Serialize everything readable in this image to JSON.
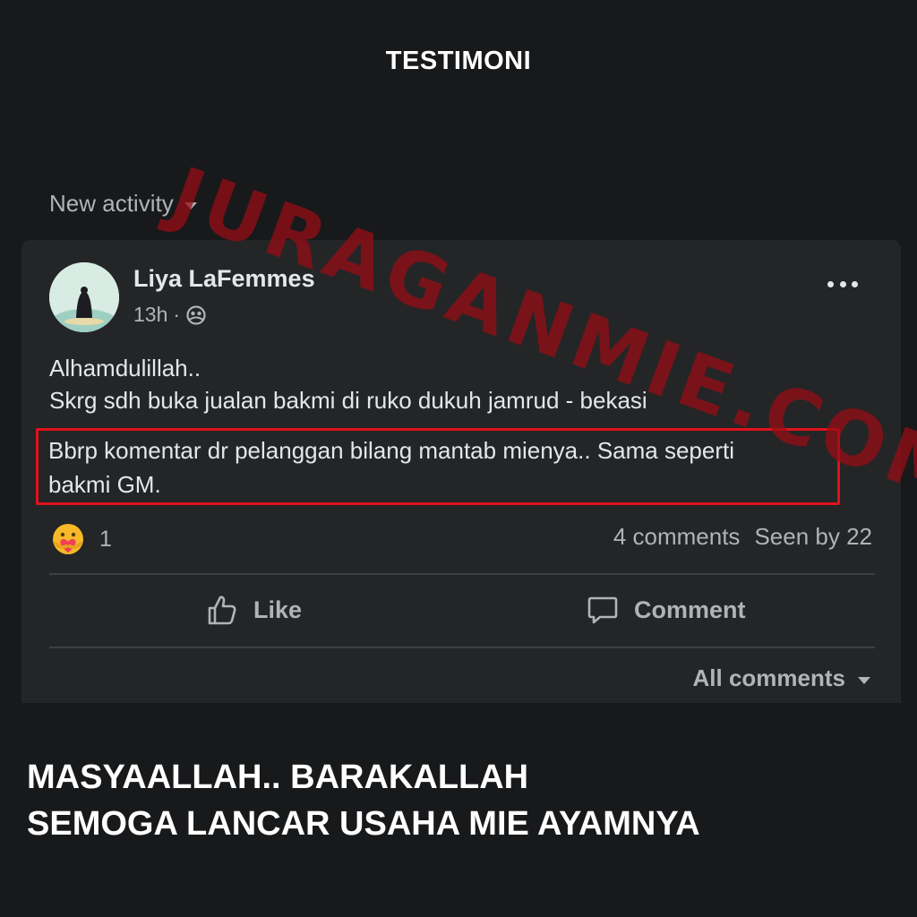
{
  "header": {
    "title": "TESTIMONI"
  },
  "feed": {
    "filter_label": "New activity"
  },
  "watermark": {
    "text": "JURAGANMIE.COM"
  },
  "post": {
    "author": "Liya LaFemmes",
    "time": "13h",
    "separator": "·",
    "privacy_icon": "group-icon",
    "body_lines": [
      "Alhamdulillah..",
      "Skrg sdh buka jualan bakmi di ruko dukuh jamrud - bekasi"
    ],
    "highlighted_lines": [
      "Bbrp komentar dr pelanggan bilang mantab mienya.. Sama seperti",
      "bakmi GM."
    ],
    "reaction_icon": "care-reaction-icon",
    "reaction_count": "1",
    "comments_count": "4 comments",
    "seen_by": "Seen by 22",
    "actions": {
      "like": "Like",
      "comment": "Comment"
    },
    "all_comments": "All comments"
  },
  "caption": {
    "lines": [
      "MASYAALLAH.. BARAKALLAH",
      "SEMOGA LANCAR USAHA MIE AYAMNYA"
    ]
  },
  "colors": {
    "background": "#18191b",
    "card": "#242526",
    "highlight_border": "#e1111b",
    "watermark": "#960e16"
  }
}
